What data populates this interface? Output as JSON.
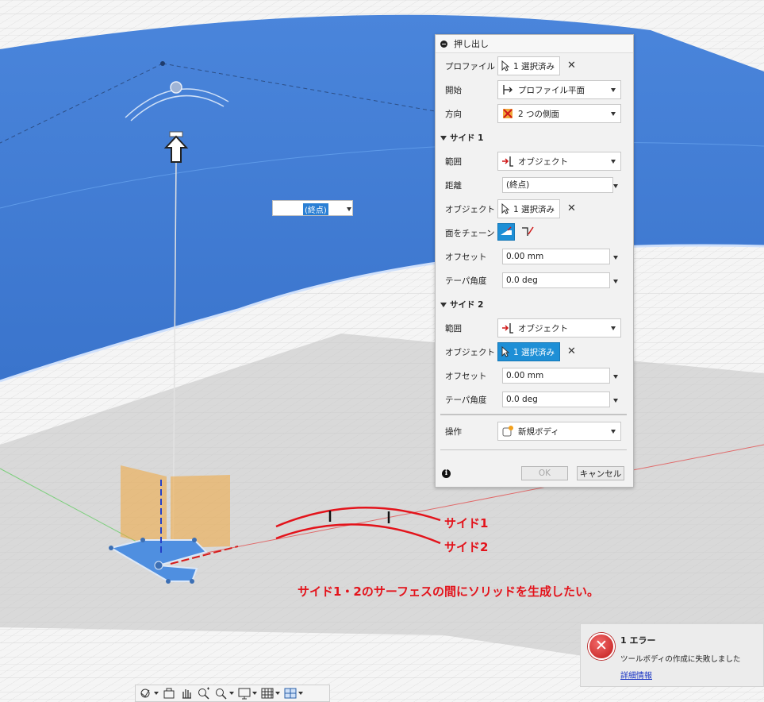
{
  "dialog": {
    "title": "押し出し",
    "profile_label": "プロファイル",
    "profile_value": "1 選択済み",
    "start_label": "開始",
    "start_value": "プロファイル平面",
    "direction_label": "方向",
    "direction_value": "2 つの側面",
    "side1": {
      "header": "サイド 1",
      "extent_label": "範囲",
      "extent_value": "オブジェクト",
      "distance_label": "距離",
      "distance_value": "(終点)",
      "object_label": "オブジェクト",
      "object_value": "1 選択済み",
      "chain_label": "面をチェーン",
      "offset_label": "オフセット",
      "offset_value": "0.00 mm",
      "taper_label": "テーパ角度",
      "taper_value": "0.0 deg"
    },
    "side2": {
      "header": "サイド 2",
      "extent_label": "範囲",
      "extent_value": "オブジェクト",
      "object_label": "オブジェクト",
      "object_value": "1 選択済み",
      "offset_label": "オフセット",
      "offset_value": "0.00 mm",
      "taper_label": "テーパ角度",
      "taper_value": "0.0 deg"
    },
    "operation_label": "操作",
    "operation_value": "新規ボディ",
    "ok_label": "OK",
    "cancel_label": "キャンセル"
  },
  "floating_input": {
    "value": "(終点)"
  },
  "annotations": {
    "side1": "サイド1",
    "side2": "サイド2",
    "note": "サイド1・2のサーフェスの間にソリッドを生成したい。",
    "color": "#e3131b"
  },
  "error": {
    "title": "1 エラー",
    "message": "ツールボディの作成に失敗しました",
    "link": "詳細情報"
  },
  "colors": {
    "surface": "#3f7bd3",
    "accent": "#1e8fd6",
    "profile": "#4f8fe0",
    "preview": "#f2b04a"
  },
  "toolbar": {
    "icons": [
      "orbit-icon",
      "look-at-icon",
      "pan-icon",
      "zoom-icon",
      "fit-icon",
      "display-icon",
      "grid-icon",
      "viewports-icon"
    ]
  }
}
